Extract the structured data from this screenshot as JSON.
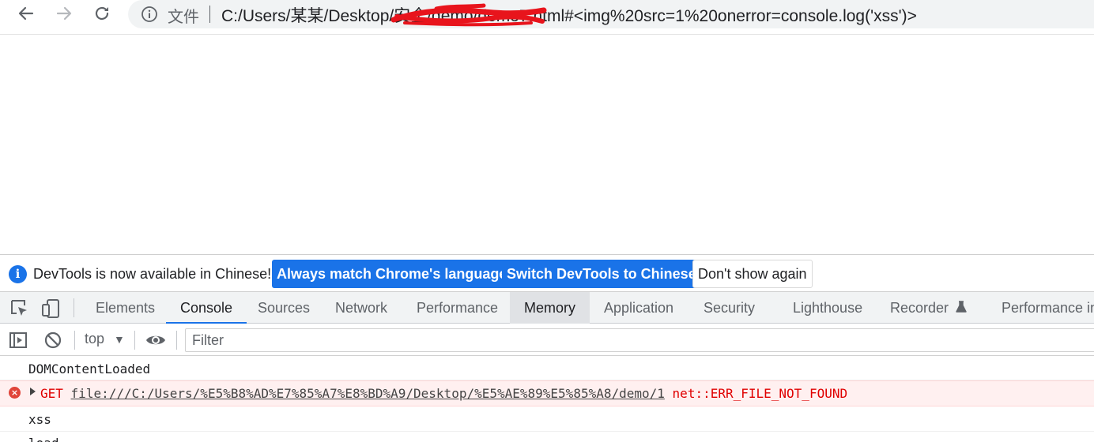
{
  "browser": {
    "omnibox": {
      "scheme_label": "文件",
      "url_text": "C:/Users/某某/Desktop/安全/demo/demo7.html#<img%20src=1%20onerror=console.log('xss')>"
    },
    "icons": {
      "back": "arrow-left-icon",
      "forward": "arrow-right-icon",
      "reload": "reload-icon",
      "info": "info-icon"
    }
  },
  "devtools": {
    "infobar": {
      "message": "DevTools is now available in Chinese!",
      "buttons": {
        "always_match": "Always match Chrome's language",
        "switch": "Switch DevTools to Chinese",
        "dont_show": "Don't show again"
      }
    },
    "tabs": [
      {
        "label": "Elements"
      },
      {
        "label": "Console"
      },
      {
        "label": "Sources"
      },
      {
        "label": "Network"
      },
      {
        "label": "Performance"
      },
      {
        "label": "Memory"
      },
      {
        "label": "Application"
      },
      {
        "label": "Security"
      },
      {
        "label": "Lighthouse"
      },
      {
        "label": "Recorder"
      },
      {
        "label": "Performance insights"
      }
    ],
    "active_tab": "Console",
    "console_toolbar": {
      "context": "top",
      "filter_placeholder": "Filter"
    },
    "messages": [
      {
        "type": "log",
        "text": "DOMContentLoaded"
      },
      {
        "type": "error",
        "method": "GET",
        "url": "file:///C:/Users/%E5%B8%AD%E7%85%A7%E8%BD%A9/Desktop/%E5%AE%89%E5%85%A8/demo/1",
        "status": "net::ERR_FILE_NOT_FOUND"
      },
      {
        "type": "log",
        "text": "xss"
      },
      {
        "type": "log",
        "text": "load"
      }
    ]
  },
  "colors": {
    "accent": "#1a73e8",
    "error_text": "#e00000",
    "error_bg": "#fff0f0",
    "redaction": "#e8141c"
  }
}
